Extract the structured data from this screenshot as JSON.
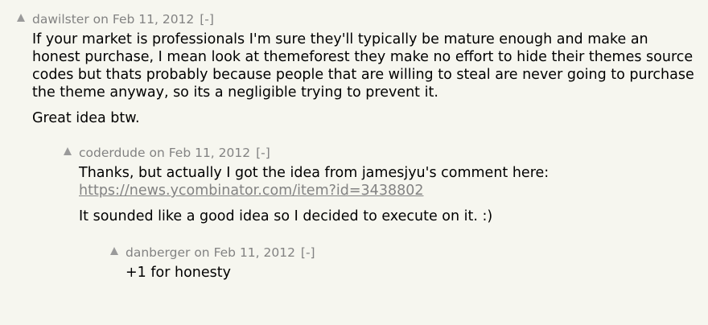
{
  "comments": [
    {
      "user": "dawilster",
      "on": "on",
      "time": "Feb 11, 2012",
      "toggle": "[-]",
      "lines": [
        "If your market is professionals I'm sure they'll typically be mature enough and make an honest purchase, I mean look at themeforest they make no effort to hide their themes source codes but thats probably because people that are willing to steal are never going to purchase the theme anyway, so its a negligible trying to prevent it.",
        "Great idea btw."
      ]
    },
    {
      "user": "coderdude",
      "on": "on",
      "time": "Feb 11, 2012",
      "toggle": "[-]",
      "intro": "Thanks, but actually I got the idea from jamesjyu's comment here:",
      "link": "https://news.ycombinator.com/item?id=3438802",
      "line2": "It sounded like a good idea so I decided to execute on it. :)"
    },
    {
      "user": "danberger",
      "on": "on",
      "time": "Feb 11, 2012",
      "toggle": "[-]",
      "lines": [
        "+1 for honesty"
      ]
    }
  ],
  "colors": {
    "background": "#f6f6ef",
    "meta": "#828282",
    "text": "#000000"
  }
}
